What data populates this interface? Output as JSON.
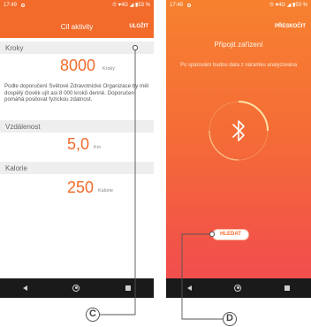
{
  "left_screen": {
    "status": {
      "time": "17:49",
      "indicators": "⏱ ♥4G ◢ ▮53 %"
    },
    "header": {
      "title": "Cíl aktivity",
      "action": "ULOŽIT"
    },
    "steps": {
      "label": "Kroky",
      "value": "8000",
      "unit": "Kroky",
      "description": "Podle doporučení Světové Zdravotnické Organizace by měl dospělý člověk ujít asi 8 000 kroků denně. Doporučení pomáhá posilovat fyzickou zdatnost."
    },
    "distance": {
      "label": "Vzdálenost",
      "value": "5,0",
      "unit": "Km"
    },
    "calories": {
      "label": "Kalorie",
      "value": "250",
      "unit": "Kalorie"
    }
  },
  "right_screen": {
    "status": {
      "time": "17:49",
      "indicators": "⏱ ♥4G ◢ ▮53 %"
    },
    "header": {
      "action": "PŘESKOČIT"
    },
    "title": "Připojit zařízení",
    "subtitle": "Po spárování budou data z náramku analyzována",
    "scan_button": "HLEDAT"
  },
  "callouts": {
    "c": "C",
    "d": "D"
  },
  "colors": {
    "accent": "#f26b2b",
    "gradient_top": "#f7812f",
    "gradient_bottom": "#f04a4f"
  },
  "icons": [
    "bluetooth-icon",
    "back-icon",
    "home-icon",
    "recent-apps-icon",
    "alarm-icon",
    "signal-icon",
    "battery-icon"
  ]
}
